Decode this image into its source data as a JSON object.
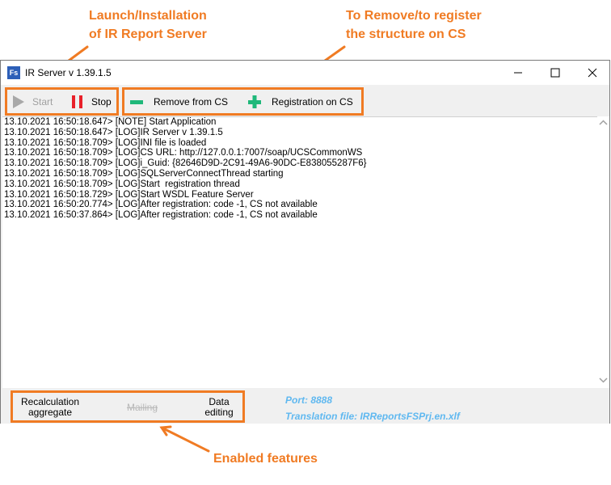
{
  "callouts": {
    "launch_line1": "Launch/Installation",
    "launch_line2": "of IR Report Server",
    "register_line1": "To Remove/to register",
    "register_line2": "the structure on CS",
    "features": "Enabled features"
  },
  "window": {
    "app_icon": "Fs",
    "title": "IR Server v 1.39.1.5"
  },
  "toolbar": {
    "start_label": "Start",
    "stop_label": "Stop",
    "remove_label": "Remove from CS",
    "register_label": "Registration on CS"
  },
  "log": [
    "13.10.2021 16:50:18.647> [NOTE] Start Application",
    "13.10.2021 16:50:18.647> [LOG]IR Server v 1.39.1.5",
    "13.10.2021 16:50:18.709> [LOG]INI file is loaded",
    "13.10.2021 16:50:18.709> [LOG]CS URL: http://127.0.0.1:7007/soap/UCSCommonWS",
    "13.10.2021 16:50:18.709> [LOG]i_Guid: {82646D9D-2C91-49A6-90DC-E838055287F6}",
    "13.10.2021 16:50:18.709> [LOG]SQLServerConnectThread starting",
    "13.10.2021 16:50:18.709> [LOG]Start  registration thread",
    "13.10.2021 16:50:18.729> [LOG]Start WSDL Feature Server",
    "13.10.2021 16:50:20.774> [LOG]After registration: code -1, CS not available",
    "13.10.2021 16:50:37.864> [LOG]After registration: code -1, CS not available"
  ],
  "statusbar": {
    "recalc_line1": "Recalculation",
    "recalc_line2": "aggregate",
    "mailing": "Mailing",
    "data_line1": "Data",
    "data_line2": "editing",
    "port": "Port: 8888",
    "translation": "Translation file: IRReportsFSPrj.en.xlf"
  },
  "colors": {
    "annotation": "#f07b23",
    "stop_icon": "#e8202a",
    "cs_icons": "#1fb87a",
    "info_text": "#5fb8f0"
  }
}
